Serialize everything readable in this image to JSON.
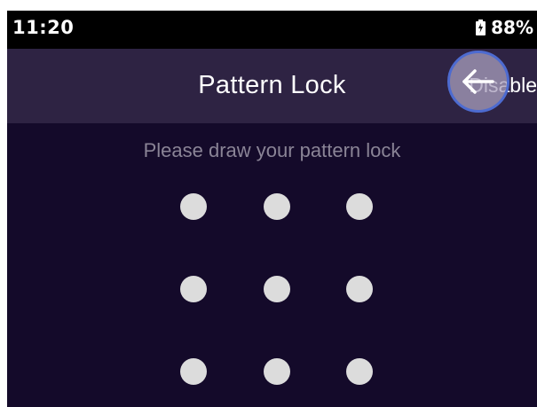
{
  "status_bar": {
    "time": "11:20",
    "battery_percent": "88%",
    "battery_icon": "battery-charging-icon"
  },
  "app_bar": {
    "title": "Pattern Lock",
    "action_label": "Disable",
    "back_icon": "back-arrow-icon"
  },
  "prompt": "Please draw your pattern lock",
  "pattern": {
    "rows": 3,
    "cols": 3
  },
  "colors": {
    "status_bar_bg": "#000000",
    "app_bar_bg": "#2e2343",
    "screen_bg": "#140a2a",
    "dot": "#dcdcdc",
    "prompt_text": "#8a8496",
    "overlay_ring": "#4d6bd0"
  }
}
